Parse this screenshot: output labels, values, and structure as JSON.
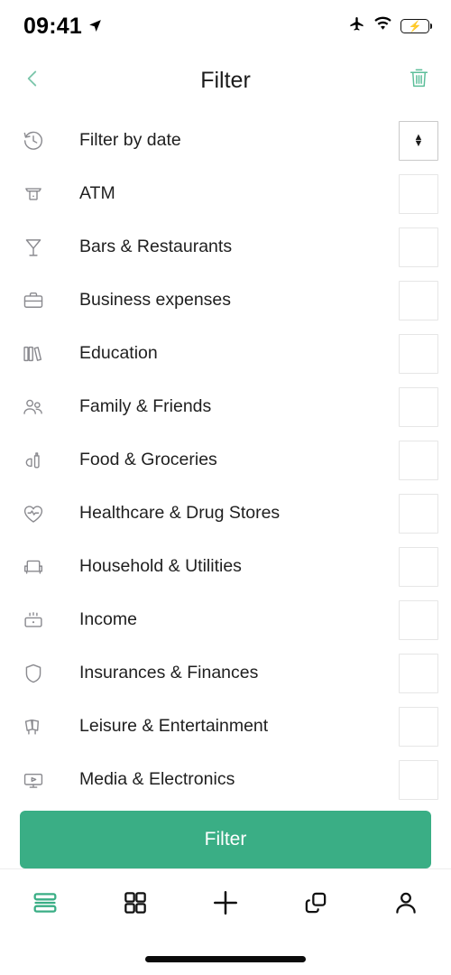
{
  "status_bar": {
    "time": "09:41",
    "location_icon": "location-arrow-icon",
    "airplane_icon": "airplane-mode-icon",
    "wifi_icon": "wifi-icon",
    "battery_icon": "battery-charging-icon",
    "battery_color": "#34C759"
  },
  "header": {
    "title": "Filter",
    "back_icon": "chevron-left-icon",
    "delete_icon": "trash-icon",
    "accent": "#6FC3A4"
  },
  "filters": [
    {
      "label": "Filter by date",
      "icon": "clock-history-icon",
      "control": "select",
      "value": ""
    },
    {
      "label": "ATM",
      "icon": "atm-icon",
      "control": "checkbox",
      "checked": false
    },
    {
      "label": "Bars & Restaurants",
      "icon": "cocktail-glass-icon",
      "control": "checkbox",
      "checked": false
    },
    {
      "label": "Business expenses",
      "icon": "briefcase-icon",
      "control": "checkbox",
      "checked": false
    },
    {
      "label": "Education",
      "icon": "books-icon",
      "control": "checkbox",
      "checked": false
    },
    {
      "label": "Family & Friends",
      "icon": "people-icon",
      "control": "checkbox",
      "checked": false
    },
    {
      "label": "Food & Groceries",
      "icon": "groceries-icon",
      "control": "checkbox",
      "checked": false
    },
    {
      "label": "Healthcare & Drug Stores",
      "icon": "heart-pulse-icon",
      "control": "checkbox",
      "checked": false
    },
    {
      "label": "Household & Utilities",
      "icon": "armchair-icon",
      "control": "checkbox",
      "checked": false
    },
    {
      "label": "Income",
      "icon": "income-card-icon",
      "control": "checkbox",
      "checked": false
    },
    {
      "label": "Insurances & Finances",
      "icon": "shield-icon",
      "control": "checkbox",
      "checked": false
    },
    {
      "label": "Leisure & Entertainment",
      "icon": "tickets-icon",
      "control": "checkbox",
      "checked": false
    },
    {
      "label": "Media & Electronics",
      "icon": "monitor-play-icon",
      "control": "checkbox",
      "checked": false
    }
  ],
  "cta": {
    "label": "Filter",
    "color": "#3AAE85"
  },
  "tabbar": {
    "items": [
      {
        "icon": "list-view-icon",
        "active": true
      },
      {
        "icon": "grid-view-icon",
        "active": false
      },
      {
        "icon": "plus-icon",
        "active": false
      },
      {
        "icon": "layers-copy-icon",
        "active": false
      },
      {
        "icon": "person-icon",
        "active": false
      }
    ],
    "active_color": "#3AAE85"
  }
}
